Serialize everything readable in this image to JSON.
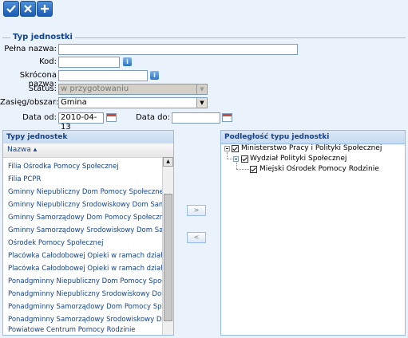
{
  "toolbar": {
    "buttons": [
      {
        "icon": "check-icon"
      },
      {
        "icon": "close-icon"
      },
      {
        "icon": "plus-icon"
      }
    ]
  },
  "form": {
    "legend": "Typ jednostki",
    "full_name_label": "Pełna nazwa:",
    "full_name_value": "",
    "code_label": "Kod:",
    "code_value": "",
    "short_name_label": "Skrócona nazwa:",
    "short_name_value": "",
    "status_label": "Status:",
    "status_value": "w przygotowaniu",
    "scope_label": "Zasięg/obszar:",
    "scope_value": "Gmina",
    "date_from_label": "Data od:",
    "date_from_value": "2010-04-13",
    "date_to_label": "Data do:",
    "date_to_value": ""
  },
  "left_panel": {
    "title": "Typy jednostek",
    "column": "Nazwa ▴",
    "rows": [
      "Filia Ośrodka Pomocy Społecznej",
      "Filia PCPR",
      "Gminny Niepubliczny Dom Pomocy Społecznej",
      "Gminny Niepubliczny Środowiskowy Dom Samopomo",
      "Gminny Samorządowy Dom Pomocy Społecznej",
      "Gminny Samorządowy Środowiskowy Dom Samopor",
      "Ośrodek Pomocy Społecznej",
      "Placówka Całodobowej Opieki w ramach działalności",
      "Placówka Całodobowej Opieki w ramach działalności",
      "Ponadgminny Niepubliczny Dom Pomocy Społecznej",
      "Ponadgminny Niepubliczny Środowiskowy Dom Samc",
      "Ponadgminny Samorządowy Dom Pomocy Społeczne",
      "Ponadgminny Samorządowy Środowiskowy Dom Sa",
      "Powiatowe Centrum Pomocy Rodzinie"
    ]
  },
  "move_buttons": {
    "right": ">",
    "left": "<"
  },
  "right_panel": {
    "title": "Podległość typu jednostki",
    "tree": [
      "Ministerstwo Pracy i Polityki Społecznej",
      "Wydział Polityki Społecznej",
      "Miejski Ośrodek Pomocy Rodzinie"
    ]
  }
}
